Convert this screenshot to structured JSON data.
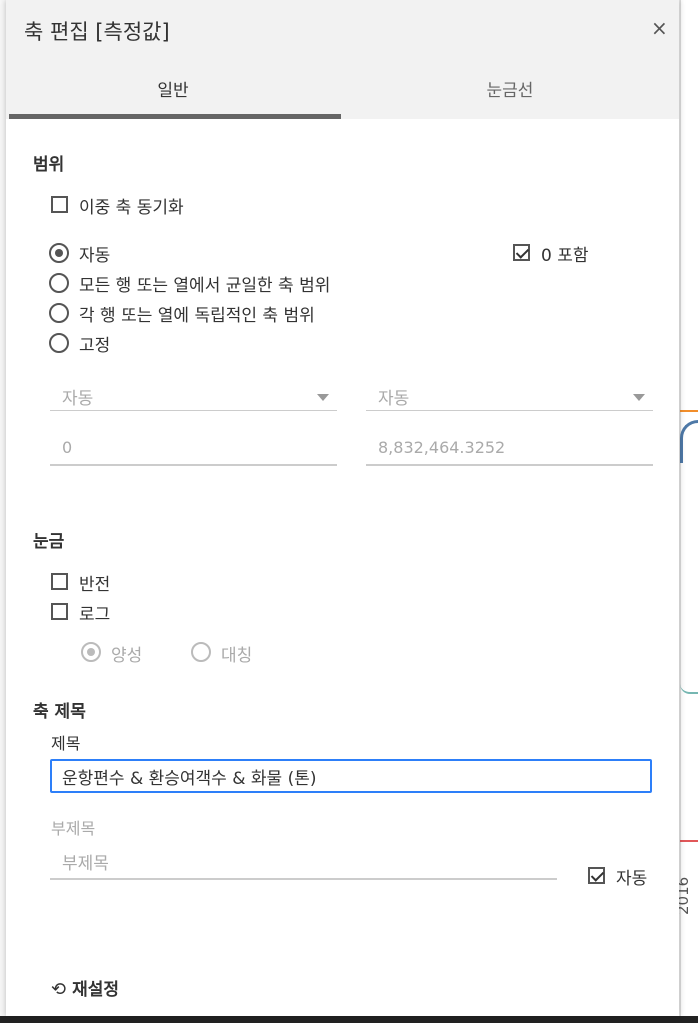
{
  "dialog": {
    "title": "축 편집 [측정값]",
    "close_glyph": "×",
    "tabs": [
      "일반",
      "눈금선"
    ]
  },
  "range": {
    "heading": "범위",
    "sync_dual_axis": {
      "label": "이중 축 동기화",
      "checked": false
    },
    "include_zero": {
      "label": "0 포함",
      "checked": true
    },
    "options": [
      {
        "label": "자동",
        "selected": true
      },
      {
        "label": "모든 행 또는 열에서 균일한 축 범위",
        "selected": false
      },
      {
        "label": "각 행 또는 열에 독립적인 축 범위",
        "selected": false
      },
      {
        "label": "고정",
        "selected": false
      }
    ],
    "start_select": "자동",
    "end_select": "자동",
    "start_value": "0",
    "end_value": "8,832,464.3252"
  },
  "scale": {
    "heading": "눈금",
    "reversed": {
      "label": "반전",
      "checked": false
    },
    "log": {
      "label": "로그",
      "checked": false
    },
    "positive": {
      "label": "양성",
      "selected": true
    },
    "symmetric": {
      "label": "대칭",
      "selected": false
    }
  },
  "axis_title": {
    "heading": "축 제목",
    "title_label": "제목",
    "title_value": "운항편수 & 환승여객수 & 화물 (톤)",
    "subtitle_label": "부제목",
    "subtitle_placeholder": "부제목",
    "auto": {
      "label": "자동",
      "checked": true
    }
  },
  "footer": {
    "reset_icon": "⟲",
    "reset_label": "재설정"
  },
  "background": {
    "year_label": "2016"
  }
}
